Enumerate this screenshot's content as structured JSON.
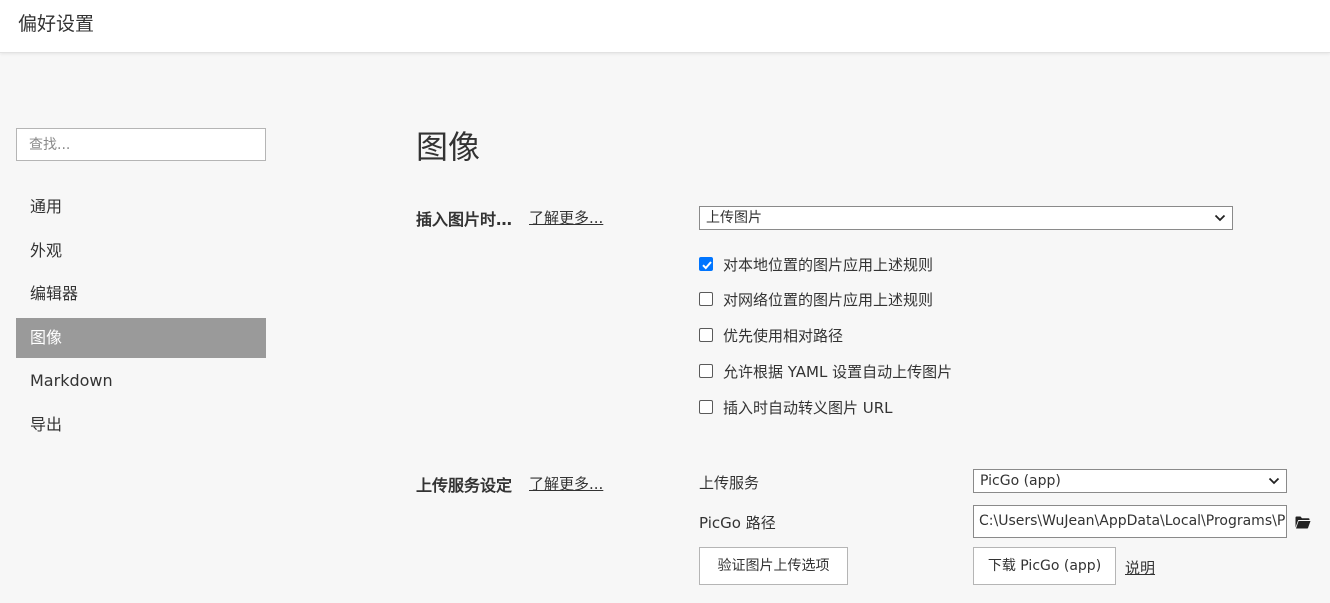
{
  "window": {
    "title": "偏好设置"
  },
  "sidebar": {
    "search_placeholder": "查找...",
    "items": [
      {
        "label": "通用"
      },
      {
        "label": "外观"
      },
      {
        "label": "编辑器"
      },
      {
        "label": "图像",
        "active": true
      },
      {
        "label": "Markdown"
      },
      {
        "label": "导出"
      }
    ]
  },
  "main": {
    "title": "图像",
    "insert_section": {
      "label": "插入图片时…",
      "learn_more": "了解更多...",
      "action_select": {
        "value": "上传图片",
        "icon": "chevron-down-icon"
      },
      "options": [
        {
          "label": "对本地位置的图片应用上述规则",
          "checked": true
        },
        {
          "label": "对网络位置的图片应用上述规则",
          "checked": false
        },
        {
          "label": "优先使用相对路径",
          "checked": false
        },
        {
          "label": "允许根据 YAML 设置自动上传图片",
          "checked": false
        },
        {
          "label": "插入时自动转义图片 URL",
          "checked": false
        }
      ]
    },
    "upload_section": {
      "label": "上传服务设定",
      "learn_more": "了解更多...",
      "service_label": "上传服务",
      "service_select": {
        "value": "PicGo (app)",
        "icon": "chevron-down-icon"
      },
      "path_label": "PicGo 路径",
      "path_value": "C:\\Users\\WuJean\\AppData\\Local\\Programs\\P",
      "path_icon": "folder-icon",
      "verify_button": "验证图片上传选项",
      "download_button": "下载 PicGo (app)",
      "help_link": "说明"
    }
  },
  "colors": {
    "accent": "#0075ff",
    "active_nav_bg": "#9a9a9a",
    "page_bg": "#f7f7f7"
  }
}
